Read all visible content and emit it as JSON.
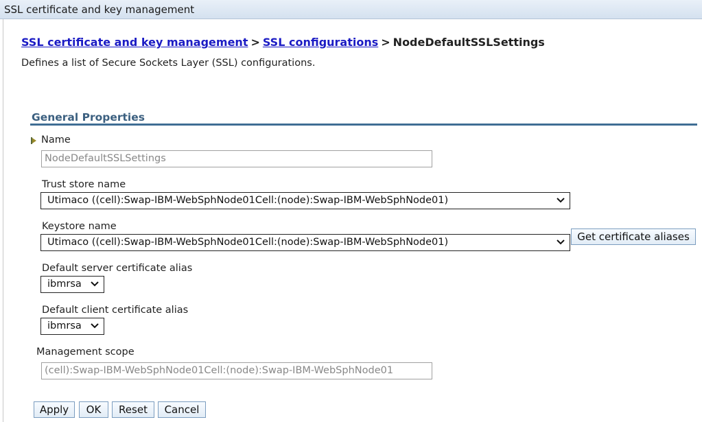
{
  "window": {
    "title": "SSL certificate and key management"
  },
  "breadcrumb": {
    "link1": "SSL certificate and key management",
    "separator": ">",
    "link2": "SSL configurations",
    "current": "NodeDefaultSSLSettings"
  },
  "description": "Defines a list of Secure Sockets Layer (SSL) configurations.",
  "general_properties": {
    "title": "General Properties",
    "name": {
      "label": "Name",
      "value": "NodeDefaultSSLSettings"
    },
    "trust_store": {
      "label": "Trust store name",
      "value": "Utimaco ((cell):Swap-IBM-WebSphNode01Cell:(node):Swap-IBM-WebSphNode01)"
    },
    "keystore": {
      "label": "Keystore name",
      "value": "Utimaco ((cell):Swap-IBM-WebSphNode01Cell:(node):Swap-IBM-WebSphNode01)",
      "get_aliases_button": "Get certificate aliases"
    },
    "server_alias": {
      "label": "Default server certificate alias",
      "value": "ibmrsa"
    },
    "client_alias": {
      "label": "Default client certificate alias",
      "value": "ibmrsa"
    },
    "management_scope": {
      "label": "Management scope",
      "value": "(cell):Swap-IBM-WebSphNode01Cell:(node):Swap-IBM-WebSphNode01"
    }
  },
  "buttons": {
    "apply": "Apply",
    "ok": "OK",
    "reset": "Reset",
    "cancel": "Cancel"
  },
  "icons": {
    "required": "required-field-icon",
    "dropdown": "chevron-down-icon"
  },
  "colors": {
    "link": "#1b1bc4",
    "section_title": "#3c6080",
    "section_rule": "#3f6d94",
    "title_bar": "#d4e1ef"
  }
}
